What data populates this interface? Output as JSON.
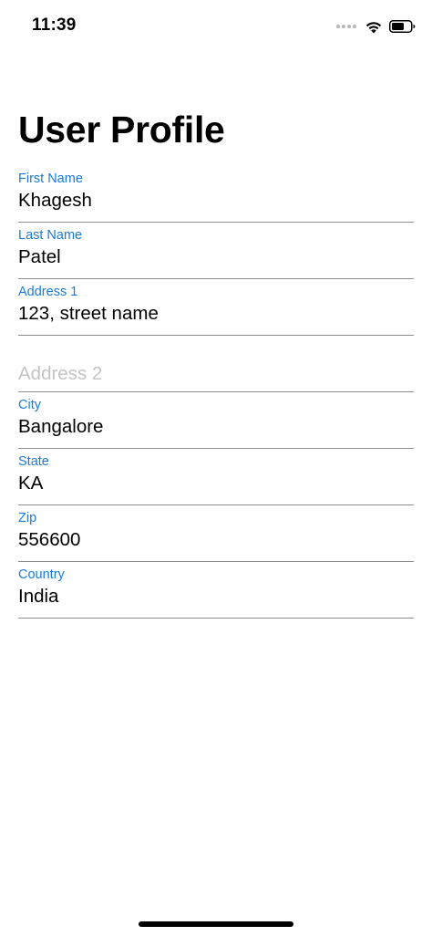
{
  "status_bar": {
    "time": "11:39"
  },
  "page": {
    "title": "User Profile"
  },
  "fields": [
    {
      "label": "First Name",
      "value": "Khagesh"
    },
    {
      "label": "Last Name",
      "value": "Patel"
    },
    {
      "label": "Address 1",
      "value": "123, street name"
    },
    {
      "label": "",
      "value": "",
      "placeholder": "Address 2"
    },
    {
      "label": "City",
      "value": "Bangalore"
    },
    {
      "label": "State",
      "value": "KA"
    },
    {
      "label": "Zip",
      "value": "556600"
    },
    {
      "label": "Country",
      "value": "India"
    }
  ],
  "icons": {
    "signal": "cellular-signal-icon",
    "wifi": "wifi-icon",
    "battery": "battery-icon"
  },
  "colors": {
    "label_accent": "#1c7ad6",
    "placeholder": "#c4c4c6",
    "divider": "#8e8e8e"
  }
}
